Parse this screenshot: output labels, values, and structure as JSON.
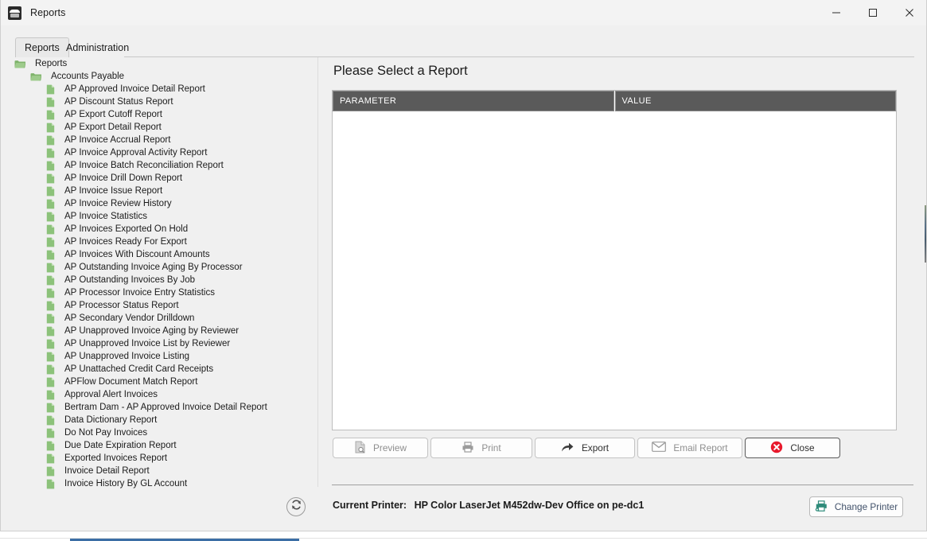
{
  "window": {
    "title": "Reports",
    "app_icon": "app-logo-icon",
    "controls": [
      {
        "name": "minimize",
        "glyph": "minimize-icon"
      },
      {
        "name": "maximize",
        "glyph": "maximize-icon"
      },
      {
        "name": "close",
        "glyph": "close-icon"
      }
    ]
  },
  "tabs": [
    {
      "label": "Reports",
      "active": true
    },
    {
      "label": "Administration",
      "active": false
    }
  ],
  "tree": {
    "nodes": [
      {
        "label": "Reports",
        "type": "folder",
        "depth": 0
      },
      {
        "label": "Accounts Payable",
        "type": "folder",
        "depth": 1
      },
      {
        "label": "AP Approved Invoice Detail Report",
        "type": "report",
        "depth": 2
      },
      {
        "label": "AP Discount Status Report",
        "type": "report",
        "depth": 2
      },
      {
        "label": "AP Export Cutoff Report",
        "type": "report",
        "depth": 2
      },
      {
        "label": "AP Export Detail Report",
        "type": "report",
        "depth": 2
      },
      {
        "label": "AP Invoice Accrual Report",
        "type": "report",
        "depth": 2
      },
      {
        "label": "AP Invoice Approval Activity Report",
        "type": "report",
        "depth": 2
      },
      {
        "label": "AP Invoice Batch Reconciliation Report",
        "type": "report",
        "depth": 2
      },
      {
        "label": "AP Invoice Drill Down Report",
        "type": "report",
        "depth": 2
      },
      {
        "label": "AP Invoice Issue Report",
        "type": "report",
        "depth": 2
      },
      {
        "label": "AP Invoice Review History",
        "type": "report",
        "depth": 2
      },
      {
        "label": "AP Invoice Statistics",
        "type": "report",
        "depth": 2
      },
      {
        "label": "AP Invoices Exported On Hold",
        "type": "report",
        "depth": 2
      },
      {
        "label": "AP Invoices Ready For Export",
        "type": "report",
        "depth": 2
      },
      {
        "label": "AP Invoices With Discount Amounts",
        "type": "report",
        "depth": 2
      },
      {
        "label": "AP Outstanding Invoice Aging By Processor",
        "type": "report",
        "depth": 2
      },
      {
        "label": "AP Outstanding Invoices By Job",
        "type": "report",
        "depth": 2
      },
      {
        "label": "AP Processor Invoice Entry Statistics",
        "type": "report",
        "depth": 2
      },
      {
        "label": "AP Processor Status Report",
        "type": "report",
        "depth": 2
      },
      {
        "label": "AP Secondary Vendor Drilldown",
        "type": "report",
        "depth": 2
      },
      {
        "label": "AP Unapproved Invoice Aging by Reviewer",
        "type": "report",
        "depth": 2
      },
      {
        "label": "AP Unapproved Invoice List by Reviewer",
        "type": "report",
        "depth": 2
      },
      {
        "label": "AP Unapproved Invoice Listing",
        "type": "report",
        "depth": 2
      },
      {
        "label": "AP Unattached Credit Card Receipts",
        "type": "report",
        "depth": 2
      },
      {
        "label": "APFlow Document Match Report",
        "type": "report",
        "depth": 2
      },
      {
        "label": "Approval Alert Invoices",
        "type": "report",
        "depth": 2
      },
      {
        "label": "Bertram Dam - AP Approved Invoice Detail Report",
        "type": "report",
        "depth": 2
      },
      {
        "label": "Data Dictionary Report",
        "type": "report",
        "depth": 2
      },
      {
        "label": "Do Not Pay Invoices",
        "type": "report",
        "depth": 2
      },
      {
        "label": "Due Date Expiration Report",
        "type": "report",
        "depth": 2
      },
      {
        "label": "Exported Invoices Report",
        "type": "report",
        "depth": 2
      },
      {
        "label": "Invoice Detail Report",
        "type": "report",
        "depth": 2
      },
      {
        "label": "Invoice History By GL Account",
        "type": "report",
        "depth": 2
      }
    ]
  },
  "main": {
    "title": "Please Select a Report",
    "grid": {
      "columns": [
        "PARAMETER",
        "VALUE"
      ],
      "rows": []
    }
  },
  "actions": [
    {
      "label": "Preview",
      "icon": "document-search-icon",
      "enabled": false
    },
    {
      "label": "Print",
      "icon": "printer-icon",
      "enabled": false
    },
    {
      "label": "Export",
      "icon": "share-arrow-icon",
      "enabled": true
    },
    {
      "label": "Email Report",
      "icon": "envelope-icon",
      "enabled": false
    },
    {
      "label": "Close",
      "icon": "close-circle-icon",
      "enabled": true
    }
  ],
  "footer": {
    "refresh_icon": "refresh-icon",
    "printer_label": "Current Printer:",
    "printer_value": "HP Color LaserJet M452dw-Dev Office on pe-dc1",
    "change_printer_label": "Change Printer",
    "change_printer_icon": "printer-icon"
  },
  "colors": {
    "window_bg": "#f0f0f0",
    "titlebar_bg": "#f3f3f3",
    "grid_header_bg": "#5a5a5a",
    "folder_green": "#7fb36b",
    "doc_green": "#8cc27a",
    "close_red": "#e8192c",
    "printer_teal": "#2e8b7a",
    "change_printer_text": "#42526b"
  }
}
